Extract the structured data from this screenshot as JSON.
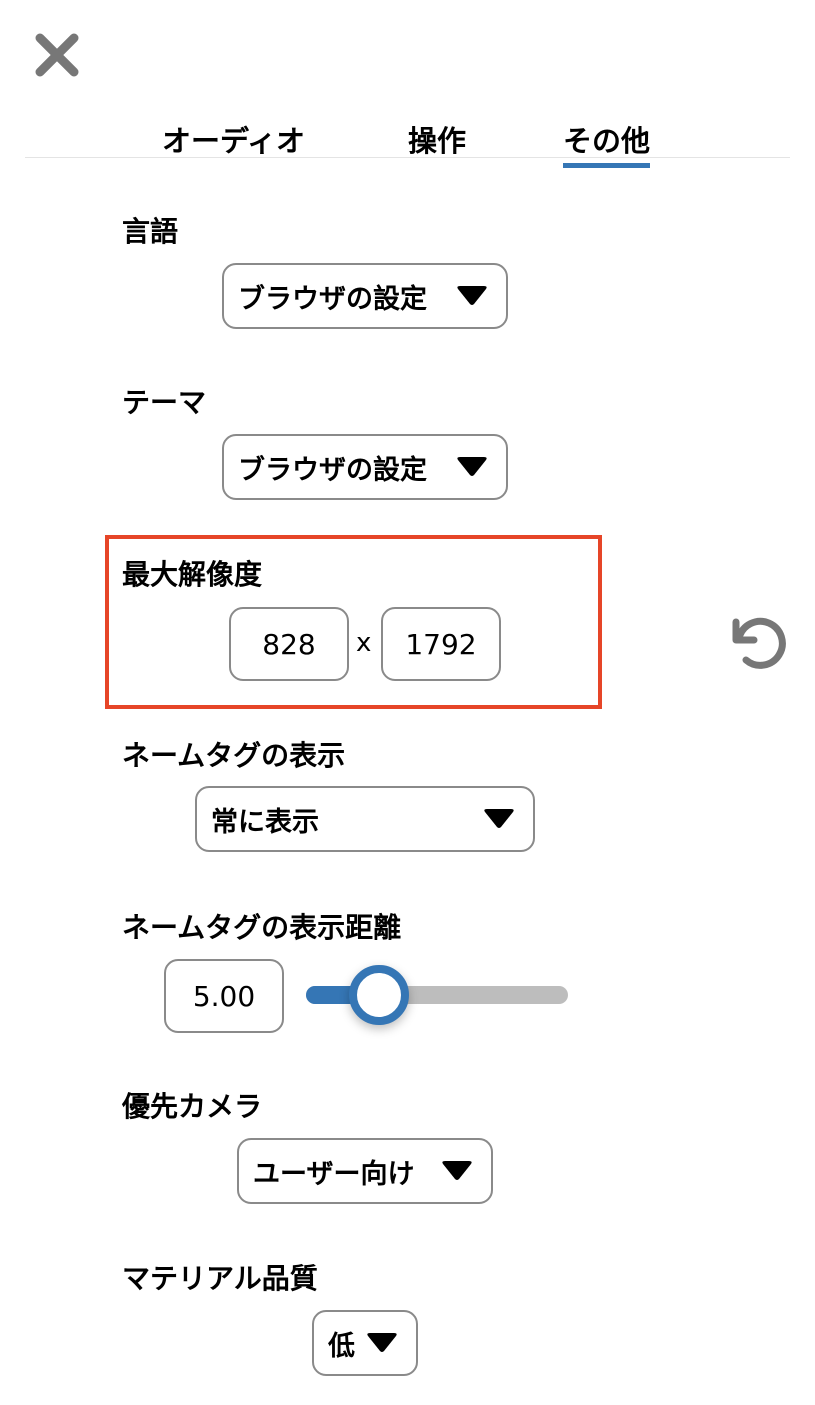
{
  "tabs": [
    {
      "label": "オーディオ",
      "active": false
    },
    {
      "label": "操作",
      "active": false
    },
    {
      "label": "その他",
      "active": true
    }
  ],
  "language": {
    "label": "言語",
    "value": "ブラウザの設定"
  },
  "theme": {
    "label": "テーマ",
    "value": "ブラウザの設定"
  },
  "resolution": {
    "label": "最大解像度",
    "width": "828",
    "separator": "x",
    "height": "1792"
  },
  "nametag_display": {
    "label": "ネームタグの表示",
    "value": "常に表示"
  },
  "nametag_distance": {
    "label": "ネームタグの表示距離",
    "value": "5.00",
    "slider_fraction": 0.28
  },
  "preferred_camera": {
    "label": "優先カメラ",
    "value": "ユーザー向け"
  },
  "material_quality": {
    "label": "マテリアル品質",
    "value": "低"
  },
  "colors": {
    "accent": "#3576b5",
    "highlight": "#e64528",
    "icon": "#777777"
  },
  "icons": {
    "close": "close-icon",
    "reset": "reset-icon",
    "dropdown": "caret-down-icon"
  }
}
